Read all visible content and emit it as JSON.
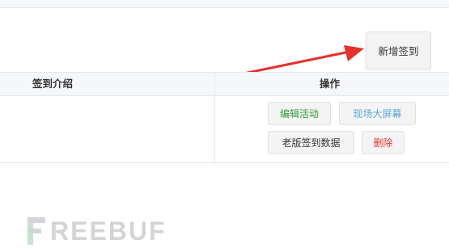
{
  "toolbar": {
    "add_label": "新增签到"
  },
  "table": {
    "headers": {
      "intro": "签到介绍",
      "actions": "操作"
    },
    "row": {
      "actions": {
        "edit": "编辑活动",
        "screen": "现场大屏幕",
        "old_data": "老版签到数据",
        "delete": "删除"
      }
    }
  },
  "watermark": {
    "text": "REEBUF"
  },
  "colors": {
    "edit": "#2f9a34",
    "screen": "#5aa7d6",
    "old_data": "#333333",
    "delete": "#e23a3a",
    "arrow": "#e5322d"
  },
  "icons": {
    "annotation": "red-arrow-icon"
  }
}
